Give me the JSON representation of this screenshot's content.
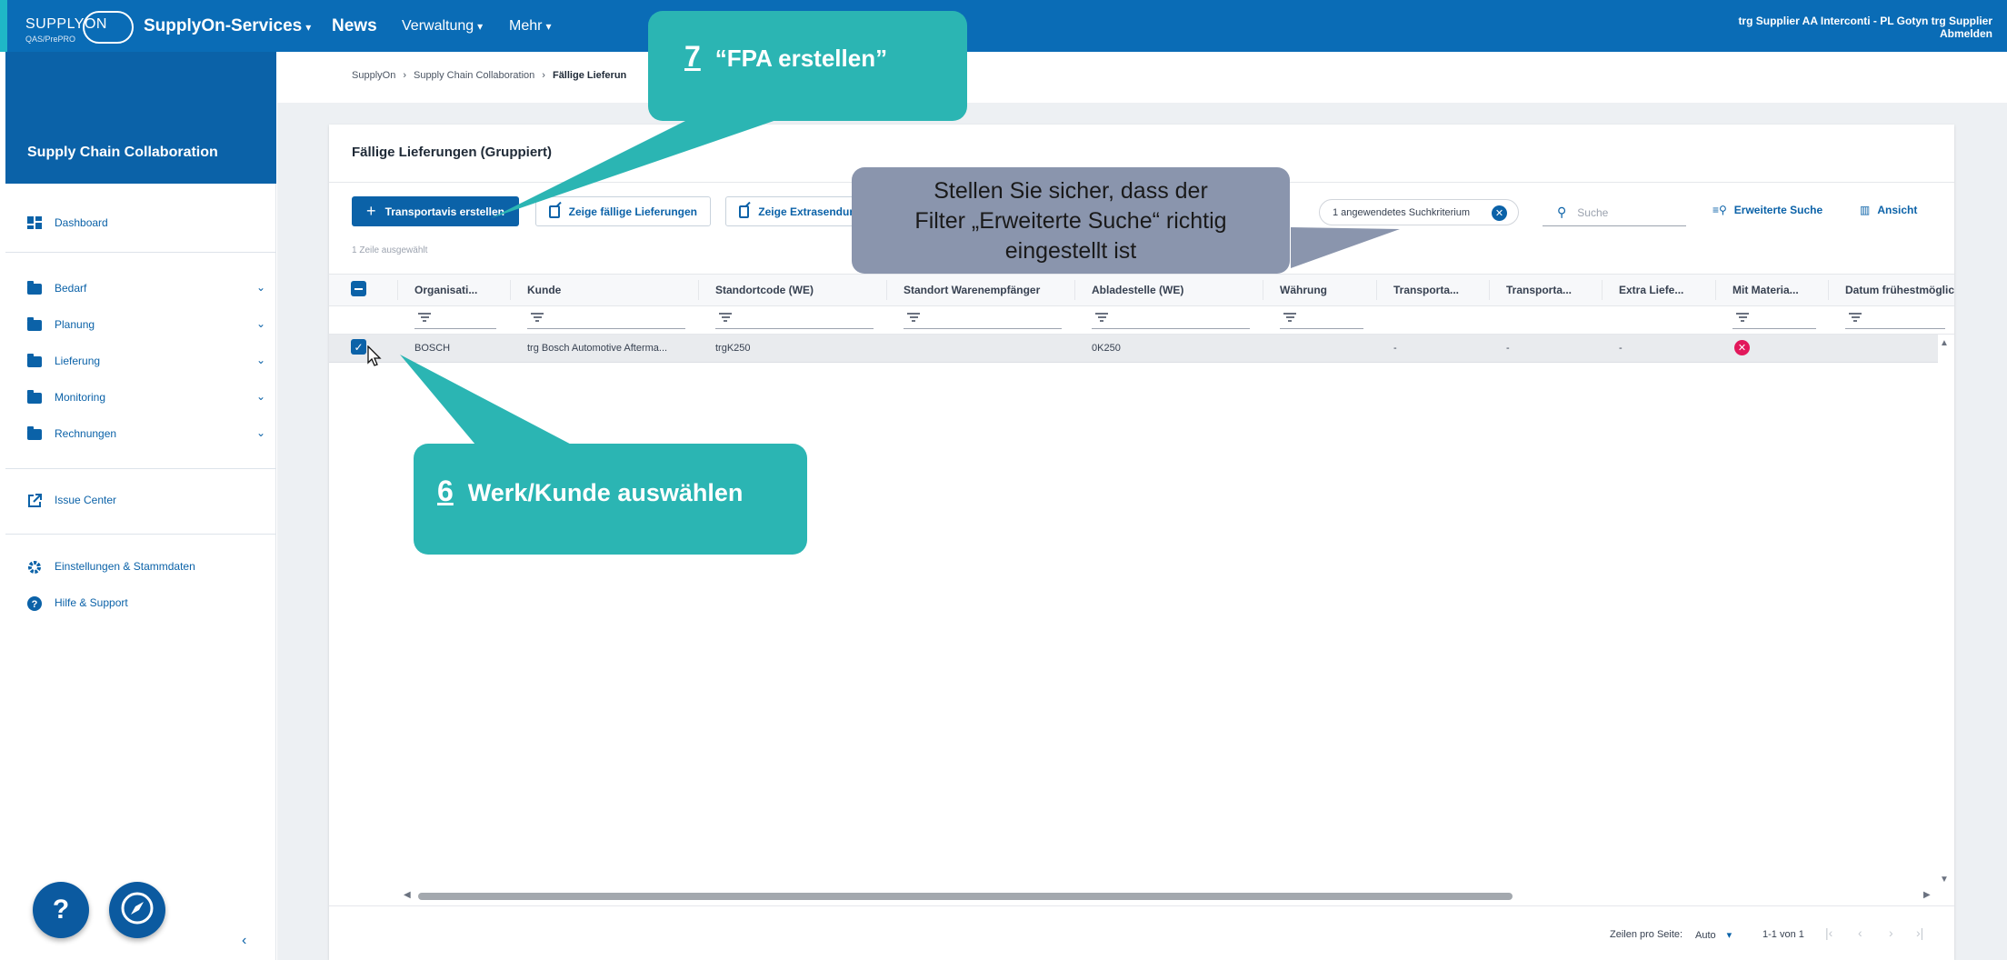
{
  "header": {
    "logo_text": "SUPPLYON",
    "logo_sub": "QAS/PrePRO",
    "nav": [
      {
        "label": "SupplyOn-Services",
        "caret": "▾"
      },
      {
        "label": "News",
        "caret": ""
      },
      {
        "label": "Verwaltung",
        "caret": "▾"
      },
      {
        "label": "Mehr",
        "caret": "▾"
      }
    ],
    "user": "trg Supplier AA Interconti - PL Gotyn trg Supplier",
    "logout": "Abmelden"
  },
  "sidebar": {
    "title": "Supply Chain Collaboration",
    "items": [
      {
        "label": "Dashboard",
        "icon": "dashboard-icon"
      },
      {
        "label": "Bedarf",
        "icon": "folder-icon"
      },
      {
        "label": "Planung",
        "icon": "folder-icon"
      },
      {
        "label": "Lieferung",
        "icon": "folder-icon"
      },
      {
        "label": "Monitoring",
        "icon": "folder-icon"
      },
      {
        "label": "Rechnungen",
        "icon": "folder-icon"
      },
      {
        "label": "Issue Center",
        "icon": "external-link-icon"
      },
      {
        "label": "Einstellungen & Stammdaten",
        "icon": "gear-icon"
      },
      {
        "label": "Hilfe & Support",
        "icon": "help-icon"
      }
    ],
    "help_symbol": "?",
    "collapse_symbol": "‹"
  },
  "breadcrumb": [
    "SupplyOn",
    "Supply Chain Collaboration",
    "Fällige Lieferun"
  ],
  "page": {
    "title": "Fällige Lieferungen (Gruppiert)",
    "primary_button": "Transportavis erstellen",
    "button_due": "Zeige fällige Lieferungen",
    "button_extra": "Zeige Extrasendungen",
    "chip": "1 angewendetes Suchkriterium",
    "search_placeholder": "Suche",
    "advanced_search": "Erweiterte Suche",
    "view": "Ansicht",
    "selected_count": "1 Zeile ausgewählt"
  },
  "grid": {
    "columns": [
      "Organisati...",
      "Kunde",
      "Standortcode (WE)",
      "Standort Warenempfänger",
      "Abladestelle (WE)",
      "Währung",
      "Transporta...",
      "Transporta...",
      "Extra Liefe...",
      "Mit Materia...",
      "Datum frühestmöglich"
    ],
    "row": {
      "organisation": "BOSCH",
      "kunde": "trg Bosch Automotive Afterma...",
      "standortcode": "trgK250",
      "standort": "",
      "abladestelle": "0K250",
      "waehrung": "",
      "transporta1": "-",
      "transporta2": "-",
      "extra": "-",
      "status_symbol": "✕"
    }
  },
  "pager": {
    "rows_per_page_label": "Zeilen pro Seite:",
    "rows_per_page_value": "Auto",
    "range": "1-1 von 1"
  },
  "callouts": {
    "step7_num": "7",
    "step7_text": "“FPA erstellen”",
    "step6_num": "6",
    "step6_text": "Werk/Kunde auswählen",
    "note_line1": "Stellen Sie sicher, dass der",
    "note_line2": "Filter „Erweiterte Suche“ richtig",
    "note_line3": "eingestellt ist"
  },
  "colors": {
    "brand_blue": "#0a6cb6",
    "sidebar_blue": "#0b62a8",
    "teal": "#2bb5b3",
    "note_gray": "#8a95ad",
    "error_red": "#e2185b"
  }
}
